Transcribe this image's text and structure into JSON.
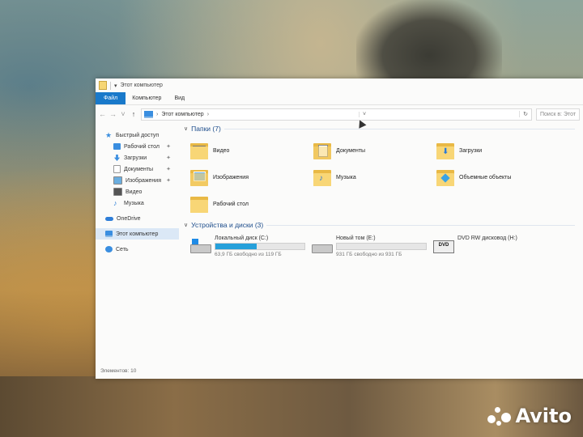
{
  "window": {
    "title": "Этот компьютер"
  },
  "ribbon": {
    "tabs": [
      "Файл",
      "Компьютер",
      "Вид"
    ]
  },
  "address": {
    "path": "Этот компьютер",
    "chevron": "›",
    "search_placeholder": "Поиск в: Этот"
  },
  "sidebar": {
    "items": [
      {
        "label": "Быстрый доступ",
        "icon": "star-icon"
      },
      {
        "label": "Рабочий стол",
        "icon": "desktop-icon",
        "pinned": true
      },
      {
        "label": "Загрузки",
        "icon": "download-icon",
        "pinned": true
      },
      {
        "label": "Документы",
        "icon": "documents-icon",
        "pinned": true
      },
      {
        "label": "Изображения",
        "icon": "pictures-icon",
        "pinned": true
      },
      {
        "label": "Видео",
        "icon": "video-icon"
      },
      {
        "label": "Музыка",
        "icon": "music-icon"
      },
      {
        "label": "OneDrive",
        "icon": "onedrive-icon"
      },
      {
        "label": "Этот компьютер",
        "icon": "this-pc-icon"
      },
      {
        "label": "Сеть",
        "icon": "network-icon"
      }
    ]
  },
  "folders_group": {
    "title": "Папки (7)",
    "items": [
      {
        "label": "Видео",
        "icon": "video-folder-icon"
      },
      {
        "label": "Документы",
        "icon": "documents-folder-icon"
      },
      {
        "label": "Загрузки",
        "icon": "downloads-folder-icon"
      },
      {
        "label": "Изображения",
        "icon": "pictures-folder-icon"
      },
      {
        "label": "Музыка",
        "icon": "music-folder-icon"
      },
      {
        "label": "Объемные объекты",
        "icon": "3d-objects-folder-icon"
      },
      {
        "label": "Рабочий стол",
        "icon": "desktop-folder-icon"
      }
    ]
  },
  "drives_group": {
    "title": "Устройства и диски (3)",
    "items": [
      {
        "name": "Локальный диск (C:)",
        "free": "63,9 ГБ свободно из 119 ГБ",
        "used_fraction": 0.46,
        "icon": "system-drive-icon"
      },
      {
        "name": "Новый том (E:)",
        "free": "931 ГБ свободно из 931 ГБ",
        "used_fraction": 0.0,
        "icon": "hard-drive-icon"
      },
      {
        "name": "DVD RW дисковод (H:)",
        "icon": "dvd-drive-icon",
        "dvd_label": "DVD"
      }
    ]
  },
  "status": {
    "items_count": "Элементов: 10"
  },
  "watermark": {
    "text": "Avito"
  }
}
